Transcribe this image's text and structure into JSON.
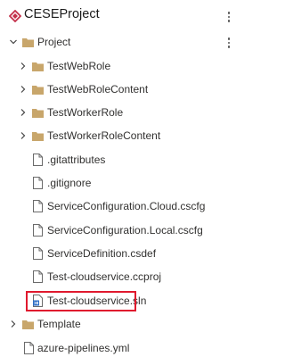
{
  "header": {
    "title": "CESEProject",
    "logo_icon": "visual-studio-solution-icon",
    "more_icon": "more-vertical-icon"
  },
  "tree": {
    "root_folder": {
      "label": "Project",
      "expanded": true
    },
    "project_items": [
      {
        "type": "folder",
        "label": "TestWebRole",
        "expanded": false
      },
      {
        "type": "folder",
        "label": "TestWebRoleContent",
        "expanded": false
      },
      {
        "type": "folder",
        "label": "TestWorkerRole",
        "expanded": false
      },
      {
        "type": "folder",
        "label": "TestWorkerRoleContent",
        "expanded": false
      },
      {
        "type": "file",
        "label": ".gitattributes"
      },
      {
        "type": "file",
        "label": ".gitignore"
      },
      {
        "type": "file",
        "label": "ServiceConfiguration.Cloud.cscfg"
      },
      {
        "type": "file",
        "label": "ServiceConfiguration.Local.cscfg"
      },
      {
        "type": "file",
        "label": "ServiceDefinition.csdef"
      },
      {
        "type": "file",
        "label": "Test-cloudservice.ccproj"
      },
      {
        "type": "solution",
        "label": "Test-cloudservice.sln",
        "highlighted": true
      }
    ],
    "template_folder": {
      "label": "Template",
      "expanded": false
    },
    "root_file": {
      "label": "azure-pipelines.yml"
    }
  },
  "colors": {
    "highlight_border": "#e0192e",
    "folder_fill": "#c8a66b",
    "logo_red": "#c4314b"
  }
}
